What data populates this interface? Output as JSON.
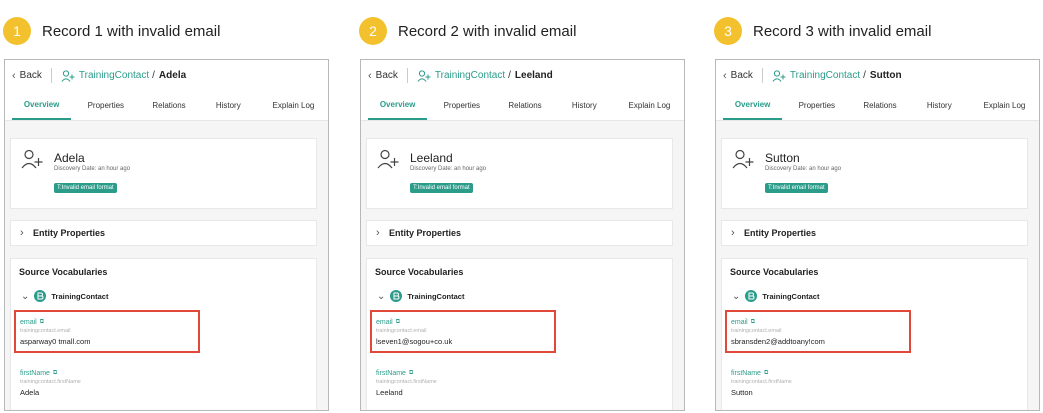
{
  "accent_color": "#2b9c8a",
  "badge_color": "#f3c12e",
  "highlight_color": "#e0493a",
  "records": [
    {
      "step_number": "1",
      "step_label": "Record 1 with invalid email",
      "back_label": "Back",
      "entity_type": "TrainingContact",
      "entity_name": "Adela",
      "tabs": [
        "Overview",
        "Properties",
        "Relations",
        "History",
        "Explain Log"
      ],
      "name": "Adela",
      "discovery": "Discovery Date: an hour ago",
      "tag": "T:Invalid email format",
      "entity_properties": "Entity Properties",
      "source_vocabularies": "Source Vocabularies",
      "vocabulary": "TrainingContact",
      "email_label": "email",
      "email_key": "trainingcontact.email",
      "email_value": "asparway0 tmall.com",
      "first_label": "firstName",
      "first_key": "trainingcontact.firstName",
      "first_value": "Adela"
    },
    {
      "step_number": "2",
      "step_label": "Record 2 with invalid email",
      "back_label": "Back",
      "entity_type": "TrainingContact",
      "entity_name": "Leeland",
      "tabs": [
        "Overview",
        "Properties",
        "Relations",
        "History",
        "Explain Log"
      ],
      "name": "Leeland",
      "discovery": "Discovery Date: an hour ago",
      "tag": "T:Invalid email format",
      "entity_properties": "Entity Properties",
      "source_vocabularies": "Source Vocabularies",
      "vocabulary": "TrainingContact",
      "email_label": "email",
      "email_key": "trainingcontact.email",
      "email_value": "lseven1@sogou+co.uk",
      "first_label": "firstName",
      "first_key": "trainingcontact.firstName",
      "first_value": "Leeland"
    },
    {
      "step_number": "3",
      "step_label": "Record 3 with invalid email",
      "back_label": "Back",
      "entity_type": "TrainingContact",
      "entity_name": "Sutton",
      "tabs": [
        "Overview",
        "Properties",
        "Relations",
        "History",
        "Explain Log"
      ],
      "name": "Sutton",
      "discovery": "Discovery Date: an hour ago",
      "tag": "T:Invalid email format",
      "entity_properties": "Entity Properties",
      "source_vocabularies": "Source Vocabularies",
      "vocabulary": "TrainingContact",
      "email_label": "email",
      "email_key": "trainingcontact.email",
      "email_value": "sbransden2@addtoany!com",
      "first_label": "firstName",
      "first_key": "trainingcontact.firstName",
      "first_value": "Sutton"
    }
  ]
}
